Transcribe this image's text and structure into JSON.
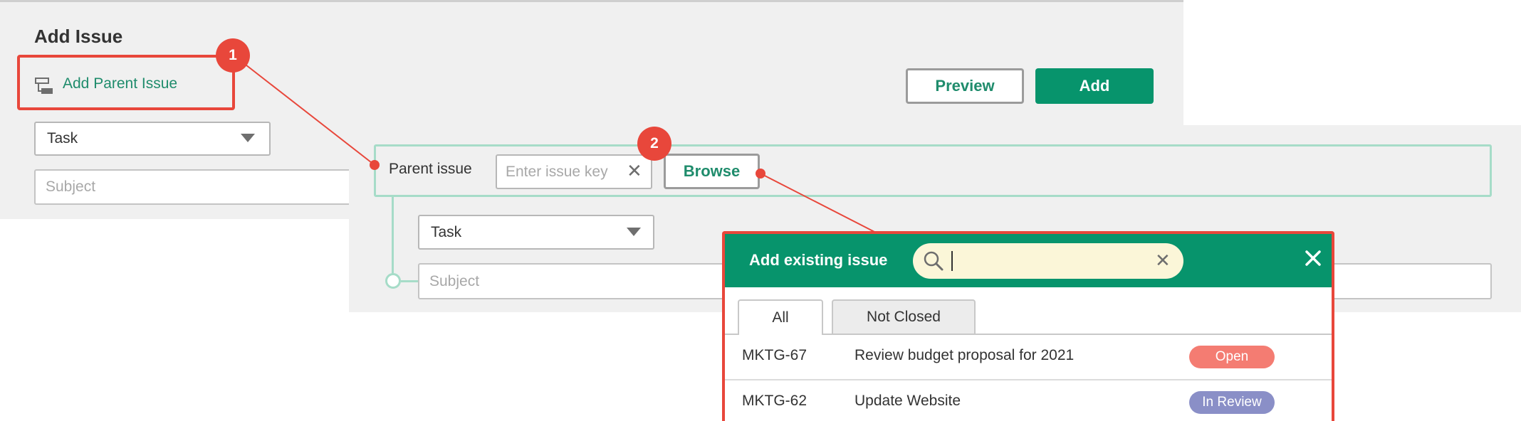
{
  "back_panel": {
    "title": "Add Issue",
    "add_parent_label": "Add Parent Issue",
    "preview_label": "Preview",
    "add_label": "Add",
    "issue_type_value": "Task",
    "subject_placeholder": "Subject"
  },
  "parent_panel": {
    "parent_label": "Parent issue",
    "issue_key_placeholder": "Enter issue key",
    "browse_label": "Browse",
    "issue_type_value": "Task",
    "subject_placeholder": "Subject"
  },
  "dialog": {
    "title": "Add existing issue",
    "search_value": "",
    "tabs": [
      {
        "label": "All",
        "active": true
      },
      {
        "label": "Not Closed",
        "active": false
      }
    ],
    "rows": [
      {
        "key": "MKTG-67",
        "summary": "Review budget proposal for 2021",
        "status": "Open",
        "status_color": "#f47c72"
      },
      {
        "key": "MKTG-62",
        "summary": "Update Website",
        "status": "In Review",
        "status_color": "#8a8fc7"
      }
    ]
  },
  "callouts": [
    "1",
    "2"
  ],
  "colors": {
    "accent_green": "#07946c",
    "callout_red": "#e8473b",
    "tree_line": "#a6dcc8",
    "search_bg": "#fbf6d8"
  }
}
